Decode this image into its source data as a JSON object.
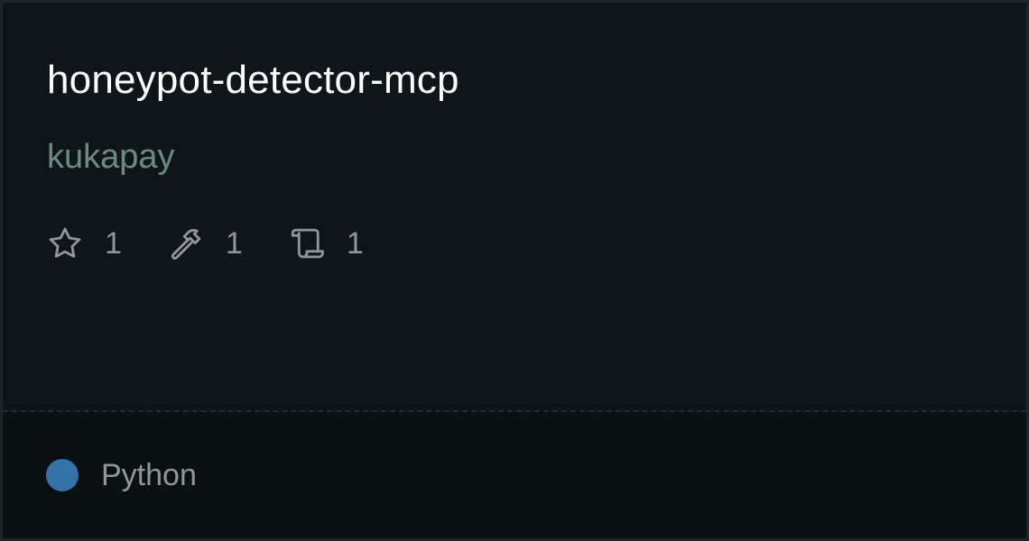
{
  "repo": {
    "name": "honeypot-detector-mcp",
    "owner": "kukapay"
  },
  "stats": [
    {
      "icon": "star-icon",
      "value": "1"
    },
    {
      "icon": "hammer-icon",
      "value": "1"
    },
    {
      "icon": "scroll-icon",
      "value": "1"
    }
  ],
  "language": {
    "name": "Python",
    "color": "#3572A5"
  },
  "colors": {
    "title": "#ffffff",
    "owner": "#6b8a82",
    "muted": "#8f979a"
  }
}
